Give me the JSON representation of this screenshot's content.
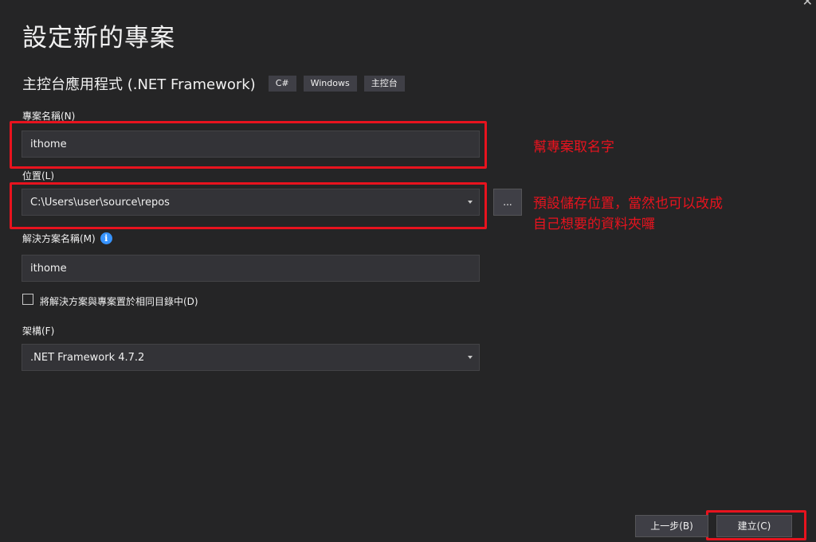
{
  "window": {
    "close_glyph": "✕"
  },
  "page_title": "設定新的專案",
  "template": {
    "name": "主控台應用程式 (.NET Framework)",
    "tags": [
      "C#",
      "Windows",
      "主控台"
    ]
  },
  "project_name": {
    "label": "專案名稱(N)",
    "value": "ithome"
  },
  "location": {
    "label": "位置(L)",
    "value": "C:\\Users\\user\\source\\repos",
    "browse_label": "..."
  },
  "solution_name": {
    "label": "解決方案名稱(M)",
    "value": "ithome",
    "info_icon": "info-icon",
    "info_glyph": "i"
  },
  "same_dir_checkbox": {
    "label": "將解決方案與專案置於相同目錄中(D)",
    "checked": false
  },
  "framework": {
    "label": "架構(F)",
    "value": ".NET Framework 4.7.2"
  },
  "annotations": {
    "project_name_note": "幫專案取名字",
    "location_note_line1": "預設儲存位置，當然也可以改成",
    "location_note_line2": "自己想要的資料夾囉"
  },
  "footer": {
    "back_label": "上一步(B)",
    "create_label": "建立(C)"
  },
  "colors": {
    "background": "#252526",
    "input_background": "#333337",
    "annotation_red": "#e8131e",
    "info_blue": "#3794ff"
  }
}
